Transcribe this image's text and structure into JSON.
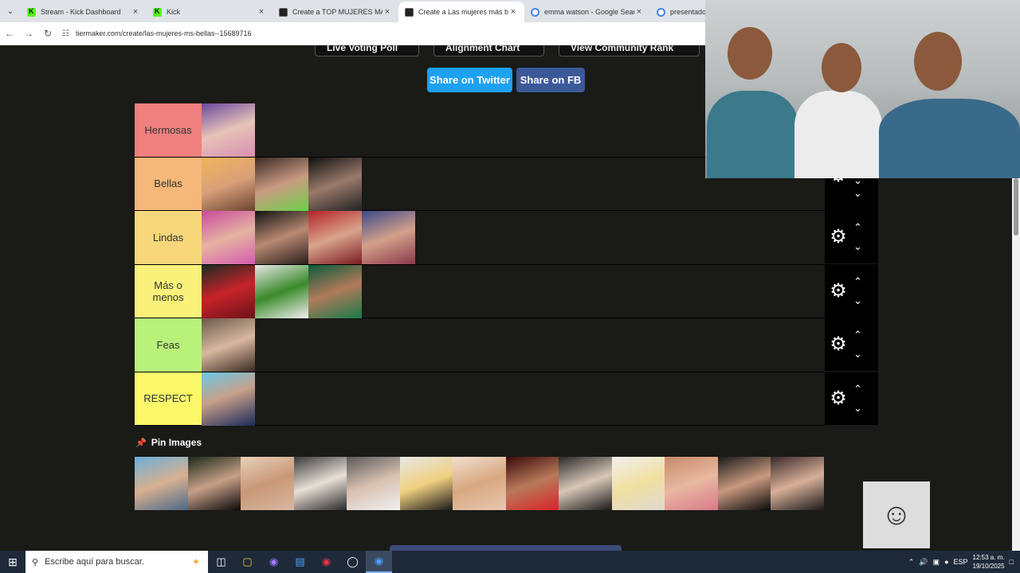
{
  "browser": {
    "tabs": [
      {
        "label": "Stream - Kick Dashboard",
        "icon": "kick",
        "active": false
      },
      {
        "label": "Kick",
        "icon": "kick",
        "active": false
      },
      {
        "label": "Create a TOP MUJERES MAS BE",
        "icon": "tiermaker",
        "active": false
      },
      {
        "label": "Create a Las mujeres más bella",
        "icon": "tiermaker",
        "active": true
      },
      {
        "label": "emma watson - Google Search",
        "icon": "google",
        "active": false
      },
      {
        "label": "presentador",
        "icon": "google",
        "active": false
      }
    ],
    "url": "tiermaker.com/create/las-mujeres-ms-bellas--15689716"
  },
  "page": {
    "top_buttons": [
      "Live Voting Poll",
      "Alignment Chart",
      "View Community Rank"
    ],
    "share_twitter": "Share on Twitter",
    "share_fb": "Share on FB",
    "tiers": [
      {
        "label": "Hermosas",
        "color": "#f07f7f",
        "items": 1
      },
      {
        "label": "Bellas",
        "color": "#f5b87a",
        "items": 3
      },
      {
        "label": "Lindas",
        "color": "#f7d77a",
        "items": 4
      },
      {
        "label": "Más o menos",
        "color": "#f9f17a",
        "items": 3
      },
      {
        "label": "Feas",
        "color": "#b8f27a",
        "items": 1
      },
      {
        "label": "RESPECT",
        "color": "#f9f96a",
        "items": 1
      }
    ],
    "pin_images_label": "Pin Images"
  },
  "taskbar": {
    "search_placeholder": "Escribe aquí para buscar.",
    "language": "ESP",
    "time": "12:53 a. m.",
    "date": "19/10/2025"
  }
}
